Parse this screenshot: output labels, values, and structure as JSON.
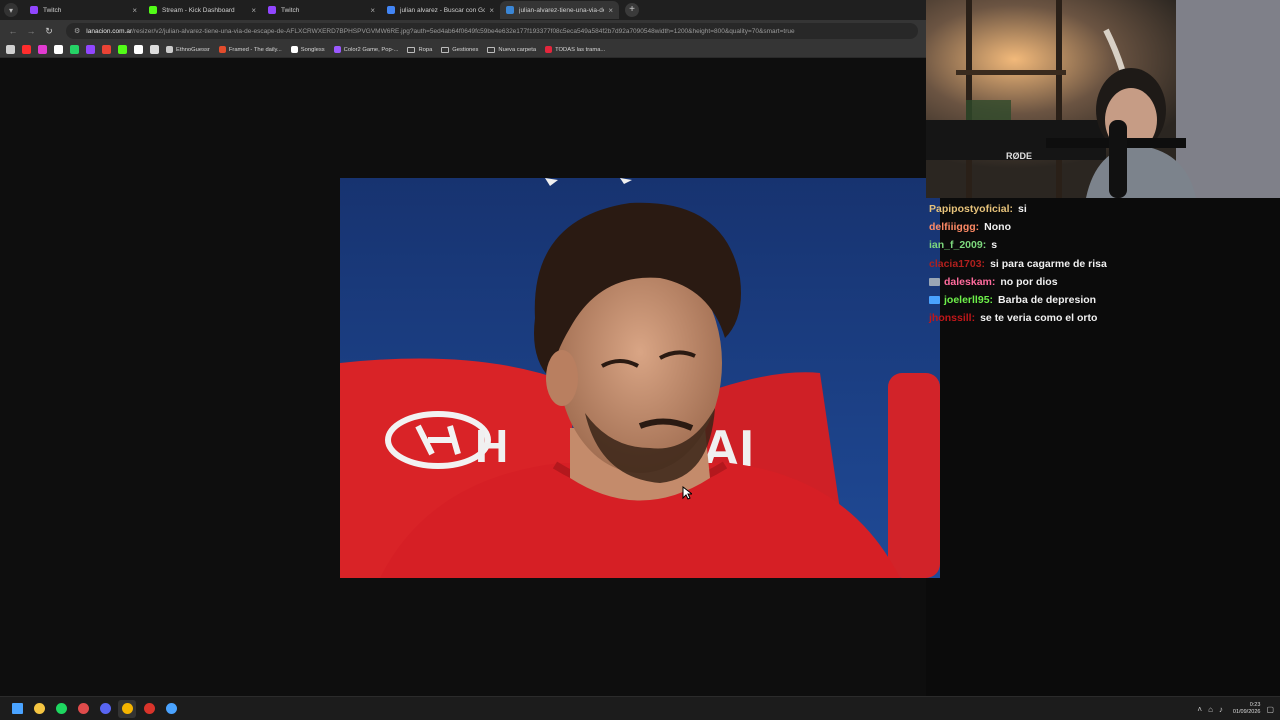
{
  "browser": {
    "tabs": [
      {
        "label": "Twitch",
        "color": "#9146ff",
        "active": false
      },
      {
        "label": "Stream - Kick Dashboard",
        "color": "#53fc18",
        "active": false
      },
      {
        "label": "Twitch",
        "color": "#9146ff",
        "active": false
      },
      {
        "label": "julian alvarez - Buscar con Goo",
        "color": "#4285f4",
        "active": false
      },
      {
        "label": "julian-alvarez-tiene-una-via-de",
        "color": "#3a86d6",
        "active": true
      }
    ],
    "close_glyph": "×",
    "new_tab_glyph": "+",
    "address": {
      "host": "lanacion.com.ar",
      "path": "/resizer/v2/julian-alvarez-tiene-una-via-de-escape-de-AFLXCRWXERD7BPHSPVGVMW6RE.jpg?auth=5ed4ab64f0649fc59be4e632e177f193377f08c5eca549a584f2b7d92a7090548width=1200&height=800&quality=70&smart=true"
    },
    "bookmarks": [
      {
        "label": "EthnoGuessr",
        "color": "#cccccc",
        "kind": "site"
      },
      {
        "label": "Framed - The daily...",
        "color": "#e34c2c",
        "kind": "site"
      },
      {
        "label": "Songless",
        "color": "#ffffff",
        "kind": "site"
      },
      {
        "label": "Color2 Game, Pop-...",
        "color": "#9b59ff",
        "kind": "site"
      },
      {
        "label": "Ropa",
        "color": "#bbbbbb",
        "kind": "folder"
      },
      {
        "label": "Gestiones",
        "color": "#bbbbbb",
        "kind": "folder"
      },
      {
        "label": "Nueva carpeta",
        "color": "#bbbbbb",
        "kind": "folder"
      },
      {
        "label": "TODAS las trama...",
        "color": "#e3263c",
        "kind": "site"
      }
    ],
    "bookmark_icons": [
      "#d0d0d0",
      "#ff2d2d",
      "#e23bd1",
      "#ffffff",
      "#25d366",
      "#9146ff",
      "#ea4335",
      "#53fc18",
      "#ffffff",
      "#dddddd"
    ]
  },
  "webcam": {
    "mic_brand": "RØDE"
  },
  "chat": {
    "messages": [
      {
        "user": "Papipostyoficial:",
        "text": "si",
        "color": "#e6c27a",
        "badge": null
      },
      {
        "user": "delfiiiggg:",
        "text": "Nono",
        "color": "#ff8a65",
        "badge": null
      },
      {
        "user": "ian_f_2009:",
        "text": "s",
        "color": "#7dd87d",
        "badge": null
      },
      {
        "user": "clacia1703:",
        "text": "si para cagarme de risa",
        "color": "#b0201e",
        "badge": null
      },
      {
        "user": "daleskam:",
        "text": "no por dios",
        "color": "#ff6b9d",
        "badge": "#9aa6b5"
      },
      {
        "user": "joelerll95:",
        "text": "Barba de depresion",
        "color": "#6ef04a",
        "badge": "#4aa3ff"
      },
      {
        "user": "jhonssill:",
        "text": "se te veria como el orto",
        "color": "#c0171a",
        "badge": null
      }
    ]
  },
  "taskbar": {
    "apps": [
      {
        "name": "windows-start-icon",
        "color": "#4aa3ff"
      },
      {
        "name": "file-explorer-icon",
        "color": "#f5c542"
      },
      {
        "name": "spotify-icon",
        "color": "#1ed760"
      },
      {
        "name": "app-red-icon",
        "color": "#e04b4b"
      },
      {
        "name": "discord-icon",
        "color": "#5865f2"
      },
      {
        "name": "chrome-icon",
        "color": "#f4b400"
      },
      {
        "name": "app-news-icon",
        "color": "#d9342b"
      },
      {
        "name": "app-refresh-icon",
        "color": "#4aa3ff"
      }
    ],
    "clock_time": "0:23",
    "clock_date": "01/09/2026"
  }
}
